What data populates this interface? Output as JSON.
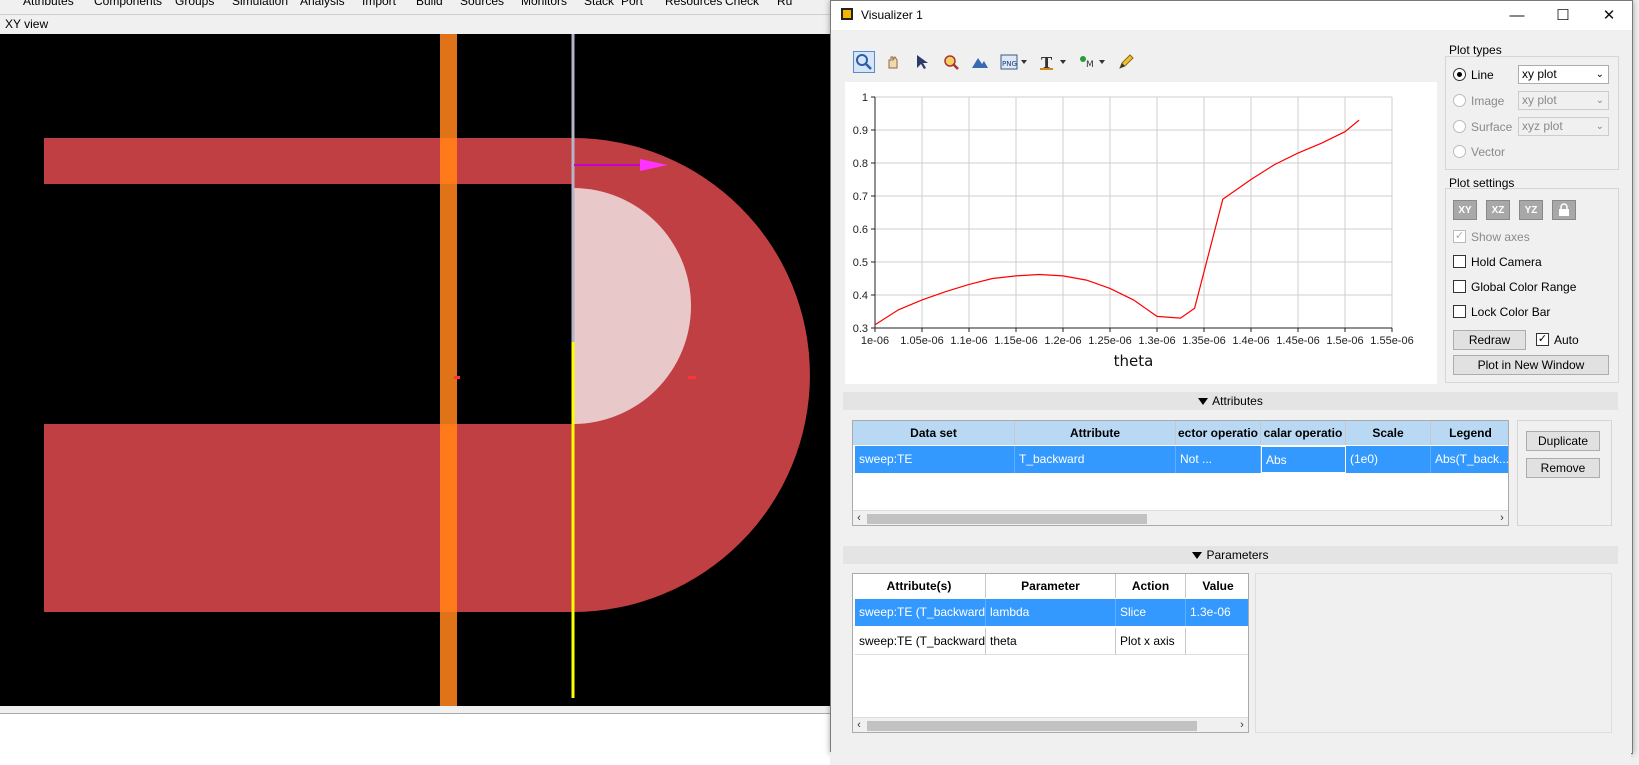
{
  "main_window": {
    "menu": [
      "Attributes",
      "Components",
      "Groups",
      "Simulation",
      "Analysis",
      "Import",
      "Build",
      "Sources",
      "Monitors",
      "Stack",
      "Port",
      "Resources",
      "Check",
      "Ru"
    ],
    "view_label": "XY view"
  },
  "visualizer": {
    "title": "Visualizer 1",
    "window_buttons": {
      "minimize": "—",
      "maximize": "☐",
      "close": "✕"
    },
    "toolbar_icons": [
      "zoom-icon",
      "pan-icon",
      "select-icon",
      "zoom-region-icon",
      "view-icon",
      "export-png-icon",
      "text-icon",
      "marker-icon",
      "pencil-icon"
    ],
    "plot": {
      "xlabel": "theta"
    },
    "attributes_section": "Attributes",
    "attributes_table": {
      "headers": [
        "Data set",
        "Attribute",
        "ector operatio",
        "calar operatio",
        "Scale",
        "Legend"
      ],
      "rows": [
        [
          "sweep:TE",
          "T_backward",
          "Not ...",
          "Abs",
          "(1e0)",
          "Abs(T_back..."
        ]
      ]
    },
    "attr_buttons": {
      "duplicate": "Duplicate",
      "remove": "Remove"
    },
    "parameters_section": "Parameters",
    "parameters_table": {
      "headers": [
        "Attribute(s)",
        "Parameter",
        "Action",
        "Value"
      ],
      "rows": [
        [
          "sweep:TE (T_backward)",
          "lambda",
          "Slice",
          "1.3e-06"
        ],
        [
          "sweep:TE (T_backward)",
          "theta",
          "Plot x axis",
          ""
        ]
      ]
    },
    "plot_types": {
      "title": "Plot types",
      "options": [
        {
          "label": "Line",
          "selected": true,
          "dropdown": "xy plot",
          "enabled": true
        },
        {
          "label": "Image",
          "selected": false,
          "dropdown": "xy plot",
          "enabled": false
        },
        {
          "label": "Surface",
          "selected": false,
          "dropdown": "xyz plot",
          "enabled": false
        },
        {
          "label": "Vector",
          "selected": false,
          "dropdown": "",
          "enabled": false
        }
      ]
    },
    "plot_settings": {
      "title": "Plot settings",
      "planes": [
        "XY",
        "XZ",
        "YZ"
      ],
      "show_axes": "Show axes",
      "hold_camera": "Hold Camera",
      "global_color_range": "Global Color Range",
      "lock_color_bar": "Lock Color Bar",
      "redraw": "Redraw",
      "auto": "Auto",
      "plot_new_window": "Plot in New Window"
    }
  },
  "chart_data": {
    "type": "line",
    "xlabel": "theta",
    "ylabel": "",
    "title": "",
    "xlim": [
      1e-06,
      1.55e-06
    ],
    "ylim": [
      0.3,
      1.0
    ],
    "x_ticks": [
      "1e-06",
      "1.05e-06",
      "1.1e-06",
      "1.15e-06",
      "1.2e-06",
      "1.25e-06",
      "1.3e-06",
      "1.35e-06",
      "1.4e-06",
      "1.45e-06",
      "1.5e-06",
      "1.55e-06"
    ],
    "y_ticks": [
      "0.3",
      "0.4",
      "0.5",
      "0.6",
      "0.7",
      "0.8",
      "0.9",
      "1"
    ],
    "grid": true,
    "series": [
      {
        "color": "#ff0000",
        "x": [
          1e-06,
          1.025e-06,
          1.05e-06,
          1.075e-06,
          1.1e-06,
          1.125e-06,
          1.15e-06,
          1.175e-06,
          1.2e-06,
          1.225e-06,
          1.25e-06,
          1.275e-06,
          1.3e-06,
          1.325e-06,
          1.34e-06,
          1.37e-06,
          1.4e-06,
          1.425e-06,
          1.45e-06,
          1.475e-06,
          1.5e-06,
          1.515e-06
        ],
        "y": [
          0.31,
          0.355,
          0.385,
          0.41,
          0.432,
          0.45,
          0.458,
          0.462,
          0.458,
          0.445,
          0.42,
          0.385,
          0.335,
          0.33,
          0.36,
          0.69,
          0.75,
          0.795,
          0.83,
          0.86,
          0.895,
          0.93
        ]
      }
    ]
  }
}
